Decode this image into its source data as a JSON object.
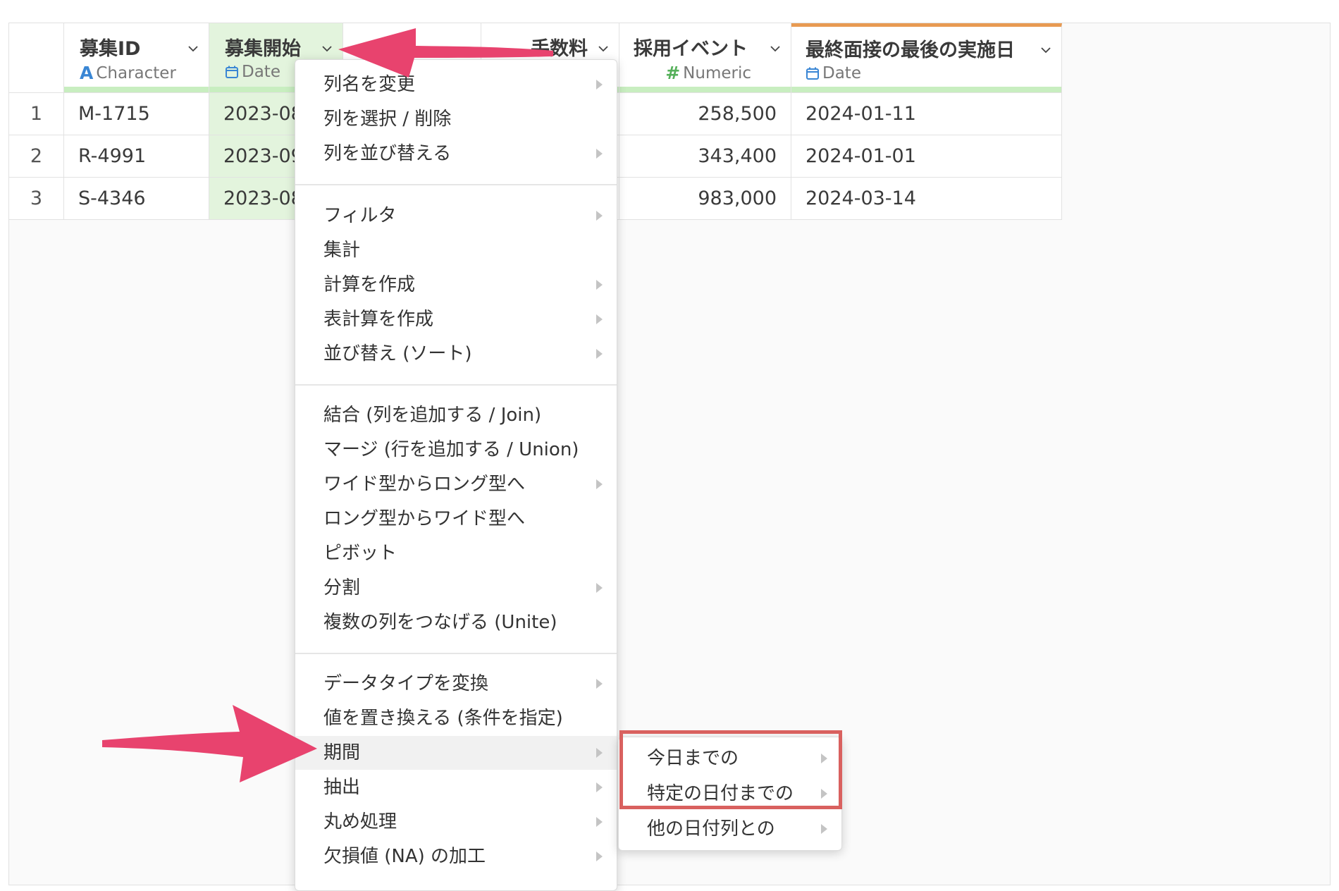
{
  "columns": [
    {
      "title": "募集ID",
      "type_label": "Character",
      "type_icon": "A"
    },
    {
      "title": "募集開始",
      "type_label": "Date"
    },
    {
      "title": "手数料"
    },
    {
      "title": "採用イベント",
      "type_label": "Numeric",
      "type_icon": "#"
    },
    {
      "title": "最終面接の最後の実施日",
      "type_label": "Date"
    }
  ],
  "rows": [
    {
      "index": "1",
      "id": "M-1715",
      "start": "2023-08",
      "event": "258,500",
      "last_interview": "2024-01-11"
    },
    {
      "index": "2",
      "id": "R-4991",
      "start": "2023-09",
      "event": "343,400",
      "last_interview": "2024-01-01"
    },
    {
      "index": "3",
      "id": "S-4346",
      "start": "2023-08",
      "event": "983,000",
      "last_interview": "2024-03-14"
    }
  ],
  "menu": {
    "rename": "列名を変更",
    "select_delete": "列を選択 / 削除",
    "reorder": "列を並び替える",
    "filter": "フィルタ",
    "aggregate": "集計",
    "create_calc": "計算を作成",
    "create_table_calc": "表計算を作成",
    "sort": "並び替え (ソート)",
    "join": "結合 (列を追加する / Join)",
    "union": "マージ (行を追加する / Union)",
    "wide_to_long": "ワイド型からロング型へ",
    "long_to_wide": "ロング型からワイド型へ",
    "pivot": "ピボット",
    "split": "分割",
    "unite": "複数の列をつなげる (Unite)",
    "convert_type": "データタイプを変換",
    "replace_values": "値を置き換える (条件を指定)",
    "period": "期間",
    "extract": "抽出",
    "round": "丸め処理",
    "na": "欠損値 (NA) の加工"
  },
  "submenu": {
    "until_today": "今日までの",
    "until_date": "特定の日付までの",
    "other_date_col": "他の日付列との"
  },
  "colors": {
    "arrow": "#e8436e",
    "highlight_border": "#d9615f",
    "date_icon": "#3a86d4",
    "column_bar": "#c8eec0",
    "accent_top": "#e89a52"
  }
}
